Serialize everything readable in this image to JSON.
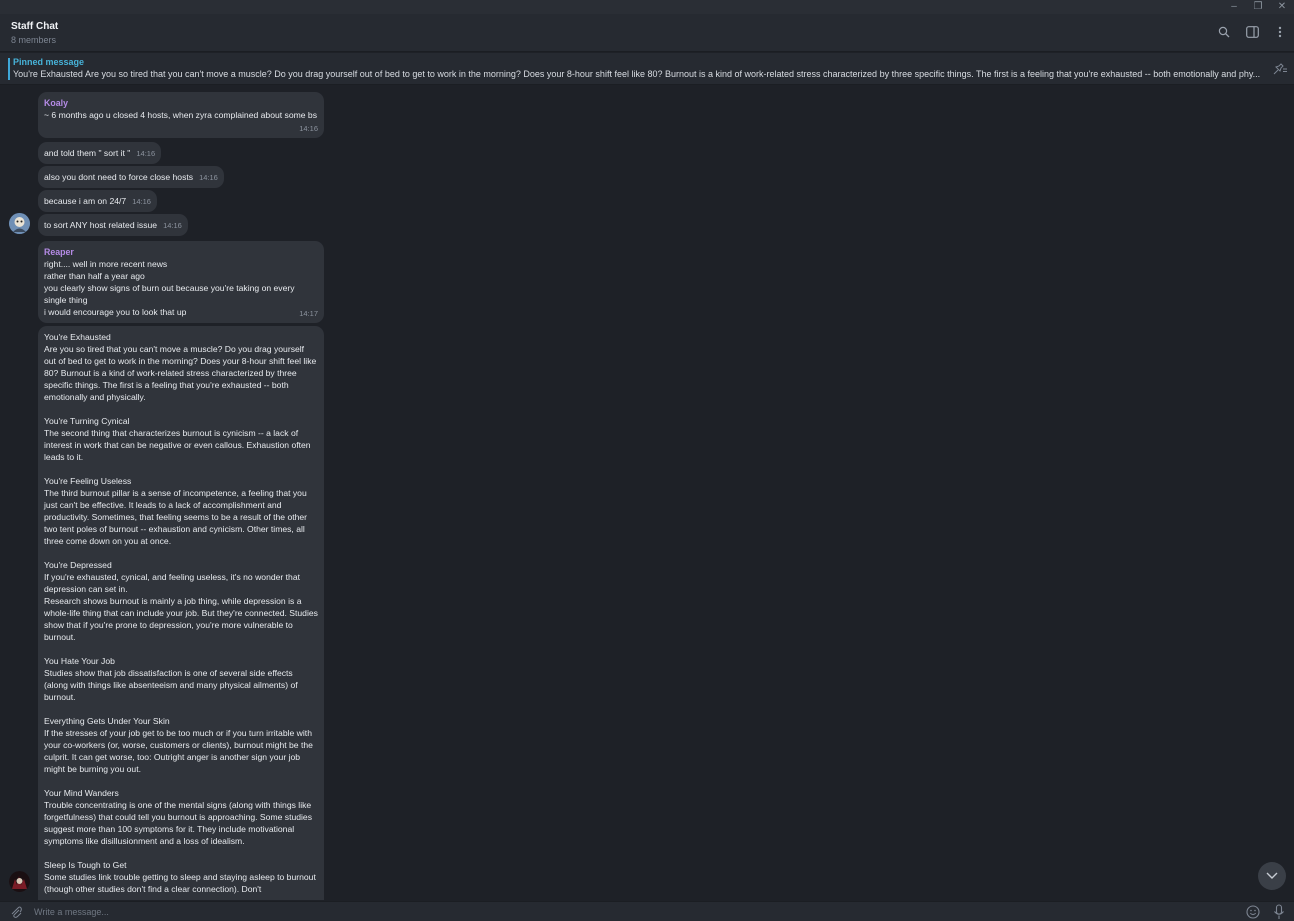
{
  "window": {
    "minimize": "–",
    "restore": "❐",
    "close": "✕"
  },
  "header": {
    "title": "Staff Chat",
    "subtitle": "8 members"
  },
  "pinned": {
    "label": "Pinned message",
    "text": "You're Exhausted Are you so tired that you can't move a muscle? Do you drag yourself out of bed to get to work in the morning? Does your 8-hour shift feel like 80? Burnout is a kind of work-related stress characterized by three specific things. The first is a feeling that you're exhausted -- both emotionally and phy..."
  },
  "messages": {
    "koaly": {
      "sender": "Koaly",
      "m1": {
        "text": "~ 6 months ago u closed 4 hosts, when zyra complained about some bs",
        "time": "14:16"
      },
      "m2": {
        "text": "and told them \" sort it \"",
        "time": "14:16"
      },
      "m3": {
        "text": "also you dont need to force close hosts",
        "time": "14:16"
      },
      "m4": {
        "text": "because i am on 24/7",
        "time": "14:16"
      },
      "m5": {
        "text": "to sort ANY host related issue",
        "time": "14:16"
      }
    },
    "reaper": {
      "sender": "Reaper",
      "m1": {
        "lines": [
          "right.... well in more recent news",
          "rather than half a year ago",
          "you clearly show signs of burn out because you're taking on every single thing",
          "i would encourage you to look that up"
        ],
        "time": "14:17"
      },
      "long": {
        "s1_title": "You're Exhausted",
        "s1_body": "Are you so tired that you can't move a muscle? Do you drag yourself out of bed to get to work in the morning? Does your 8-hour shift feel like 80? Burnout is a kind of work-related stress characterized by three specific things. The first is a feeling that you're exhausted -- both emotionally and physically.",
        "s2_title": "You're Turning Cynical",
        "s2_body": "The second thing that characterizes burnout is cynicism -- a lack of interest in work that can be negative or even callous. Exhaustion often leads to it.",
        "s3_title": "You're Feeling Useless",
        "s3_body": "The third burnout pillar is a sense of incompetence, a feeling that you just can't be effective. It leads to a lack of accomplishment and productivity. Sometimes, that feeling seems to be a result of the other two tent poles of burnout -- exhaustion and cynicism. Other times, all three come down on you at once.",
        "s4_title": "You're Depressed",
        "s4_body1": "If you're exhausted, cynical, and feeling useless, it's no wonder that depression can set in.",
        "s4_body2": "Research shows burnout is mainly a job thing, while depression is a whole-life thing that can include your job. But they're connected. Studies show that if you're prone to depression, you're more vulnerable to burnout.",
        "s5_title": "You Hate Your Job",
        "s5_body": "Studies show that job dissatisfaction is one of several side effects (along with things like absenteeism and many physical ailments) of burnout.",
        "s6_title": "Everything Gets Under Your Skin",
        "s6_body": "If the stresses of your job get to be too much or if you turn irritable with your co-workers (or, worse, customers or clients), burnout might be the culprit. It can get worse, too: Outright anger is another sign your job might be burning you out.",
        "s7_title": "Your Mind Wanders",
        "s7_body": "Trouble concentrating is one of the mental signs (along with things like forgetfulness) that could tell you burnout is approaching. Some studies suggest more than 100 symptoms for it. They include motivational symptoms like disillusionment and a loss of idealism.",
        "s8_title": "Sleep Is Tough to Get",
        "s8_body": "Some studies link trouble getting to sleep and staying asleep to burnout (though other studies don't find a clear connection). Don't"
      }
    }
  },
  "composer": {
    "placeholder": "Write a message..."
  },
  "icons": {
    "search": "search-icon",
    "sidebar": "sidebar-toggle-icon",
    "menu": "more-vertical-icon",
    "unpin": "unpin-icon",
    "attach": "paperclip-icon",
    "emoji": "emoji-icon",
    "mic": "microphone-icon",
    "scroll": "chevron-down-icon"
  },
  "colors": {
    "accent": "#47b3d9",
    "sender": "#b58be6",
    "bubble": "#30343b",
    "background": "#1e2127"
  }
}
